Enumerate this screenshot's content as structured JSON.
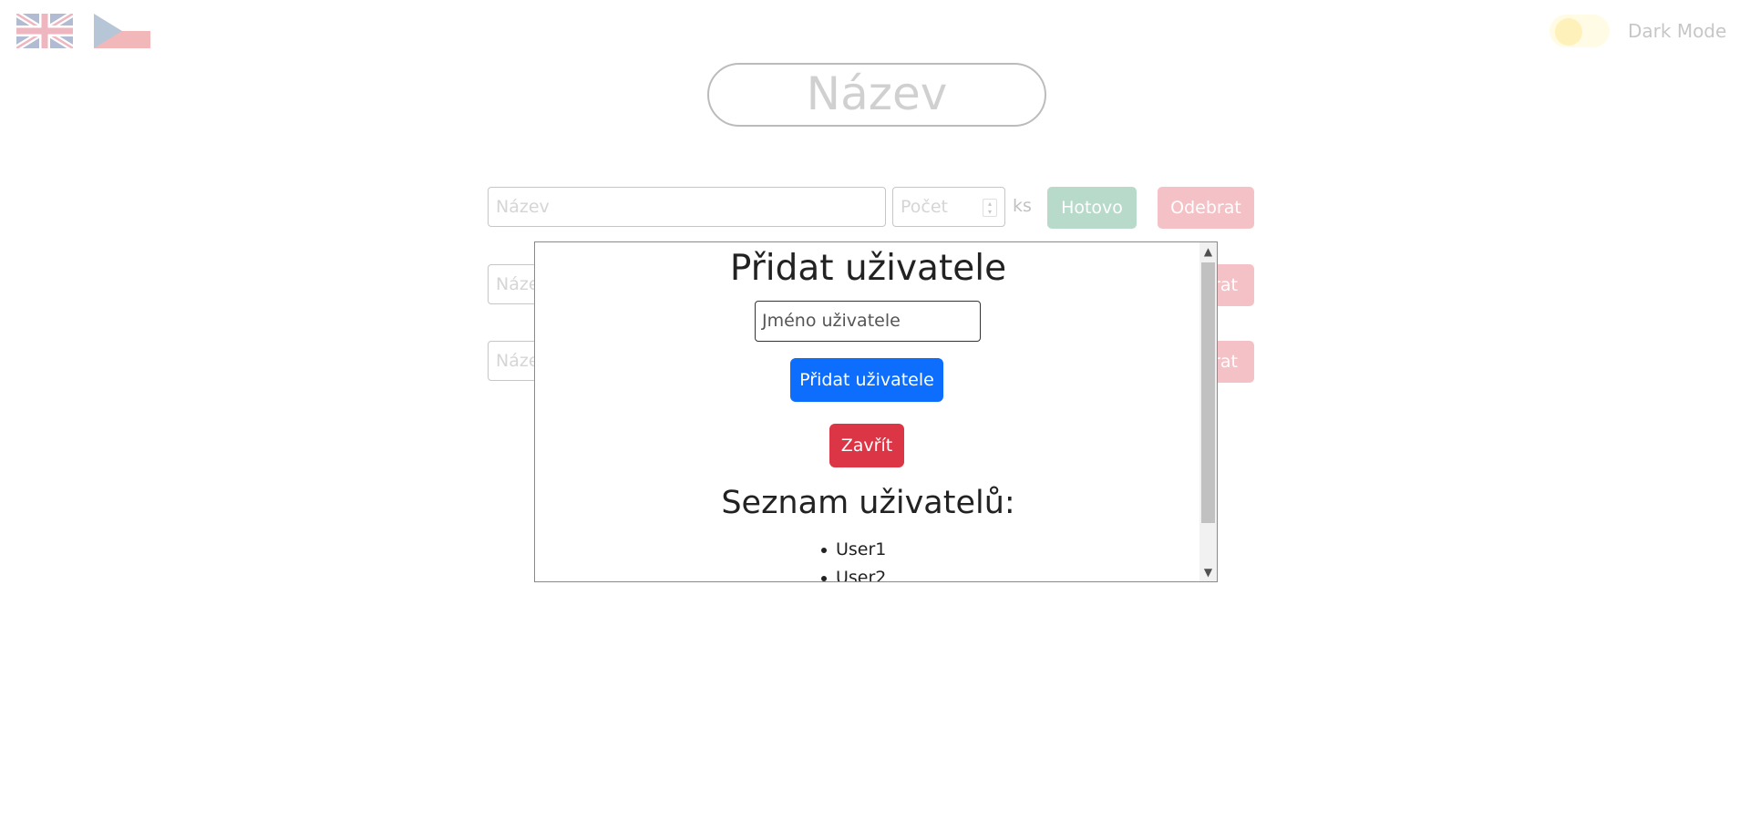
{
  "header": {
    "dark_mode_label": "Dark Mode"
  },
  "list": {
    "title_placeholder": "Název",
    "rows": [
      {
        "name_placeholder": "Název",
        "count_placeholder": "Počet",
        "unit": "ks",
        "done_label": "Hotovo",
        "remove_label": "Odebrat"
      },
      {
        "name_placeholder": "Náze",
        "remove_label": "rat"
      },
      {
        "name_placeholder": "Náze",
        "remove_label": "rat"
      }
    ]
  },
  "modal": {
    "title": "Přidat uživatele",
    "username_placeholder": "Jméno uživatele",
    "add_button": "Přidat uživatele",
    "close_button": "Zavřít",
    "users_heading": "Seznam uživatelů:",
    "users": [
      "User1",
      "User2"
    ]
  },
  "colors": {
    "success": "#198754",
    "danger": "#dc3545",
    "primary": "#0d6efd"
  },
  "icons": [
    "uk-flag-icon",
    "cz-flag-icon",
    "chevron-up-icon",
    "chevron-down-icon"
  ]
}
